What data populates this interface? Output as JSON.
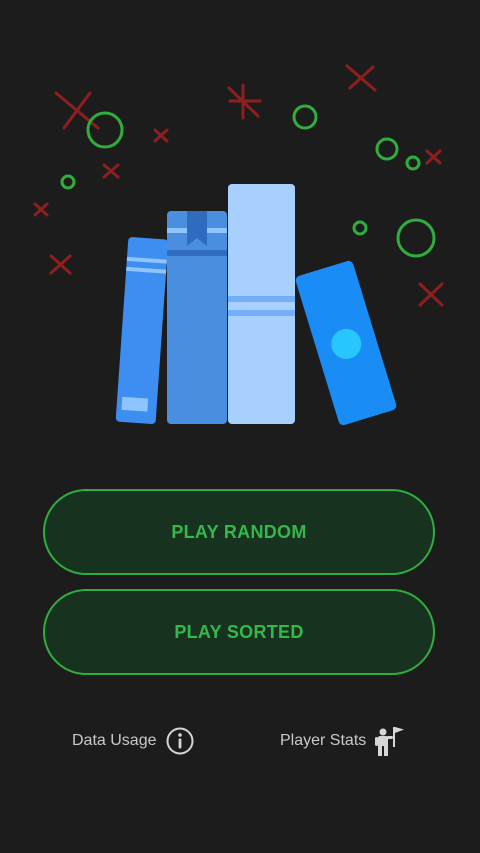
{
  "buttons": {
    "play_random": "PLAY RANDOM",
    "play_sorted": "PLAY SORTED"
  },
  "footer": {
    "data_usage_label": "Data Usage",
    "player_stats_label": "Player Stats"
  },
  "icons": {
    "hero": "books-illustration",
    "data_usage": "info-icon",
    "player_stats": "player-flag-icon"
  },
  "colors": {
    "background": "#1c1c1c",
    "accent_green": "#2fae3e",
    "button_fill": "#173320",
    "cross_red": "#8e1f1f",
    "footer_text": "#c9c9c9"
  }
}
